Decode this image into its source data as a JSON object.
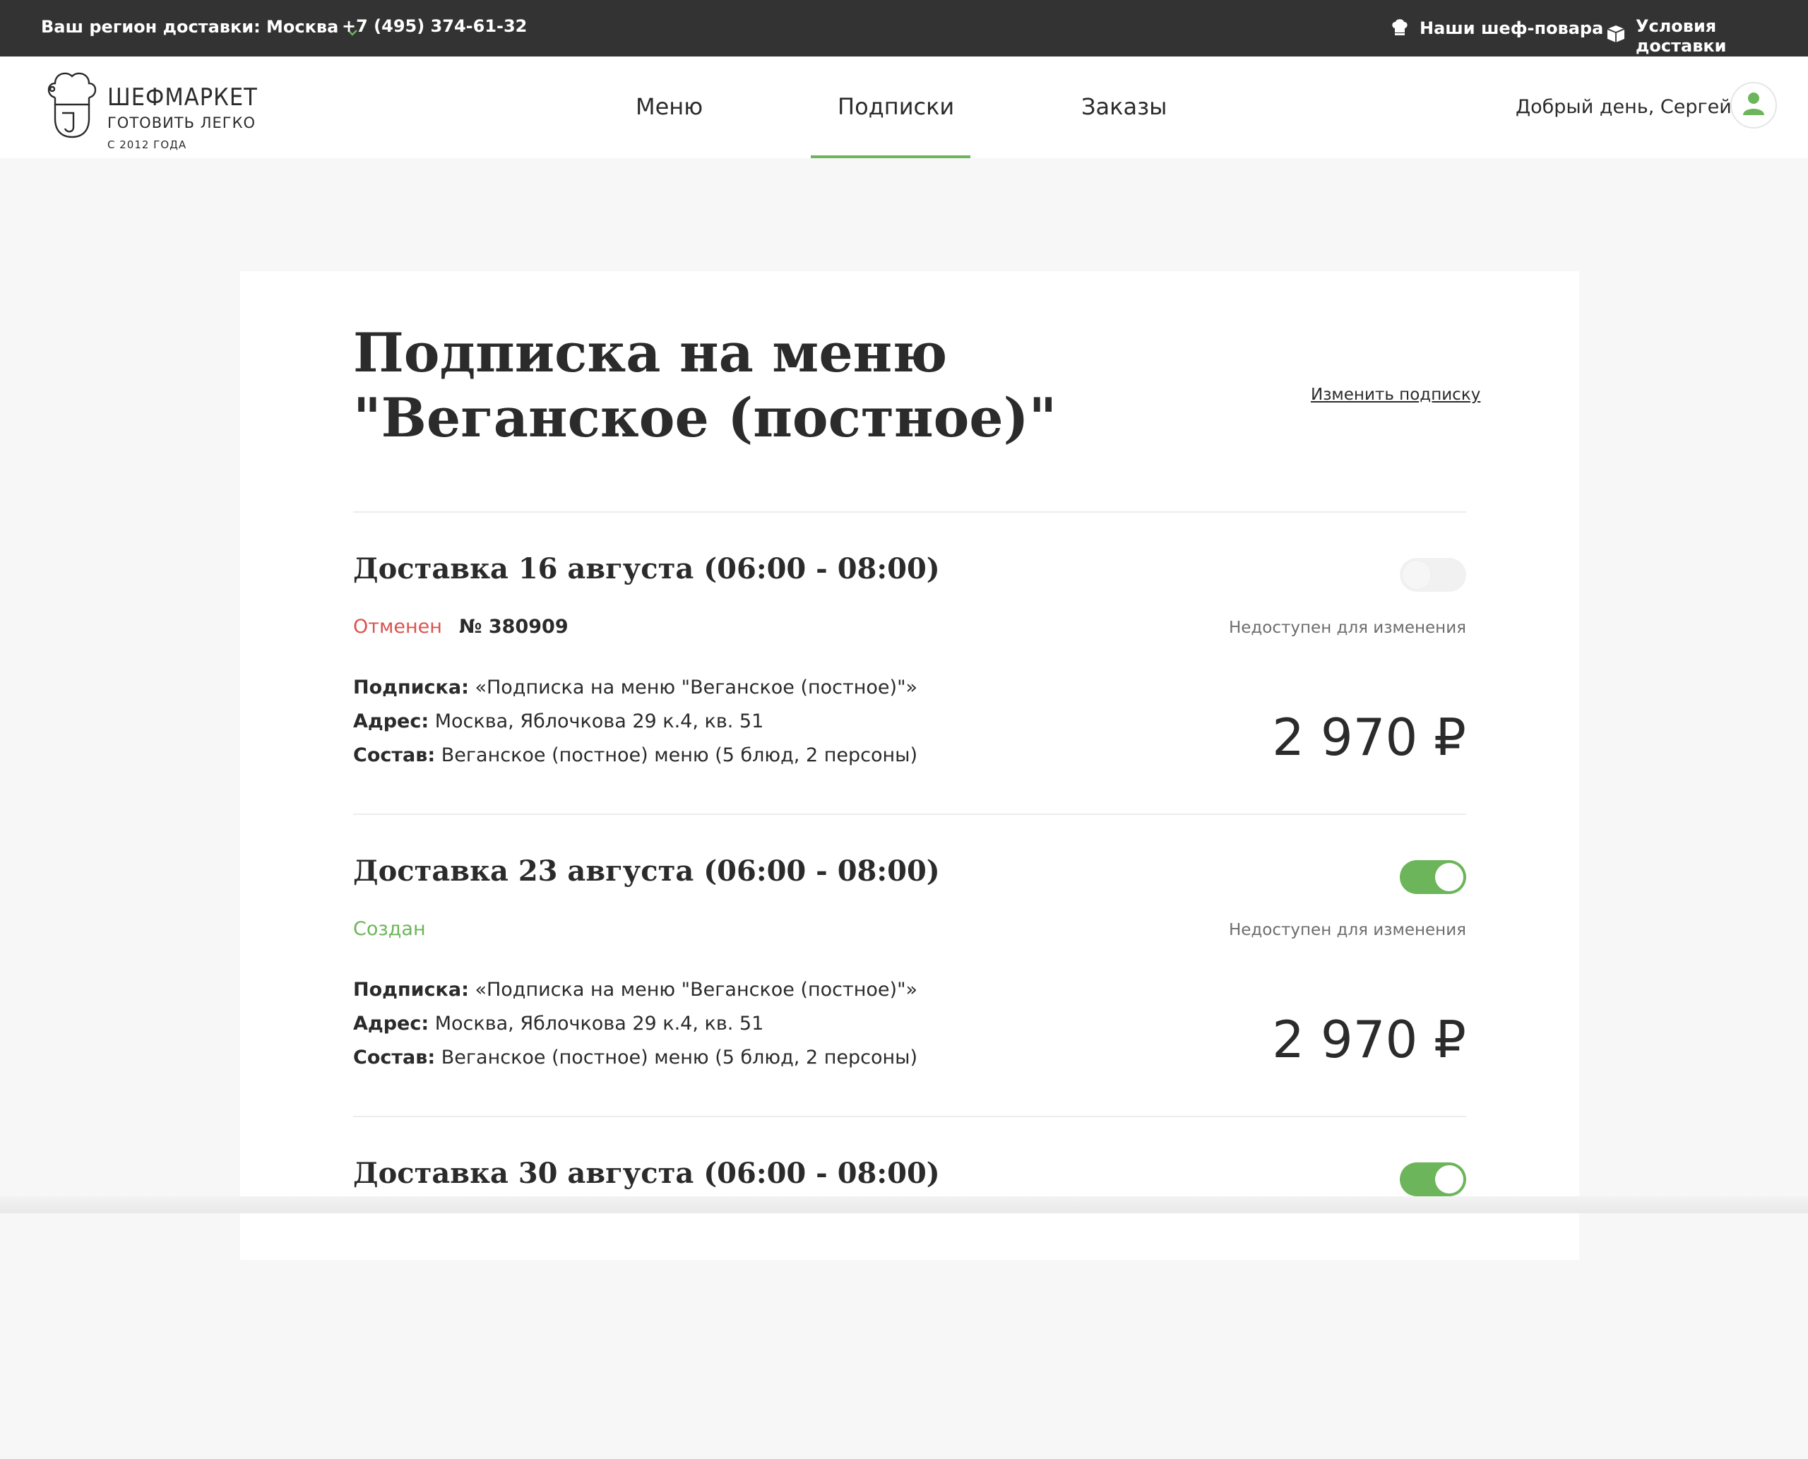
{
  "topbar": {
    "region_label": "Ваш регион доставки: Москва",
    "phone": "+7 (495) 374-61-32",
    "chefs_link": "Наши шеф-повара",
    "delivery_link": "Условия доставки"
  },
  "header": {
    "logo": {
      "brand": "ШЕФМАРКЕТ",
      "tagline": "ГОТОВИТЬ ЛЕГКО",
      "since": "С 2012 ГОДА"
    },
    "nav": [
      {
        "label": "Меню"
      },
      {
        "label": "Подписки",
        "active": true
      },
      {
        "label": "Заказы"
      }
    ],
    "greeting": "Добрый день, Сергей"
  },
  "page": {
    "title": "Подписка на меню \"Веганское (постное)\"",
    "edit_link": "Изменить подписку"
  },
  "labels": {
    "subscription": "Подписка:",
    "address": "Адрес:",
    "composition": "Состав:"
  },
  "deliveries": [
    {
      "title": "Доставка 16 августа (06:00 - 08:00)",
      "status": "Отменен",
      "order_number": "№ 380909",
      "enabled": false,
      "note": "Недоступен для изменения",
      "subscription": " «Подписка на меню \"Веганское (постное)\"»",
      "address": " Москва, Яблочкова 29 к.4, кв. 51",
      "composition": " Веганское (постное) меню (5 блюд, 2 персоны)",
      "price": "2 970 ₽"
    },
    {
      "title": "Доставка 23 августа (06:00 - 08:00)",
      "status": "Создан",
      "order_number": "",
      "enabled": true,
      "note": "Недоступен для изменения",
      "subscription": " «Подписка на меню \"Веганское (постное)\"»",
      "address": " Москва, Яблочкова 29 к.4, кв. 51",
      "composition": " Веганское (постное) меню (5 блюд, 2 персоны)",
      "price": "2 970 ₽"
    },
    {
      "title": "Доставка 30 августа (06:00 - 08:00)",
      "enabled": true
    }
  ],
  "colors": {
    "topbar_bg": "#333333",
    "accent_green": "#6cb55a",
    "cancelled_red": "#d9534f",
    "page_bg": "#f7f7f7"
  },
  "icons": {
    "region_chevron": "chevron-down-icon",
    "chefs": "chef-hat-icon",
    "delivery": "box-icon",
    "avatar": "user-icon"
  }
}
